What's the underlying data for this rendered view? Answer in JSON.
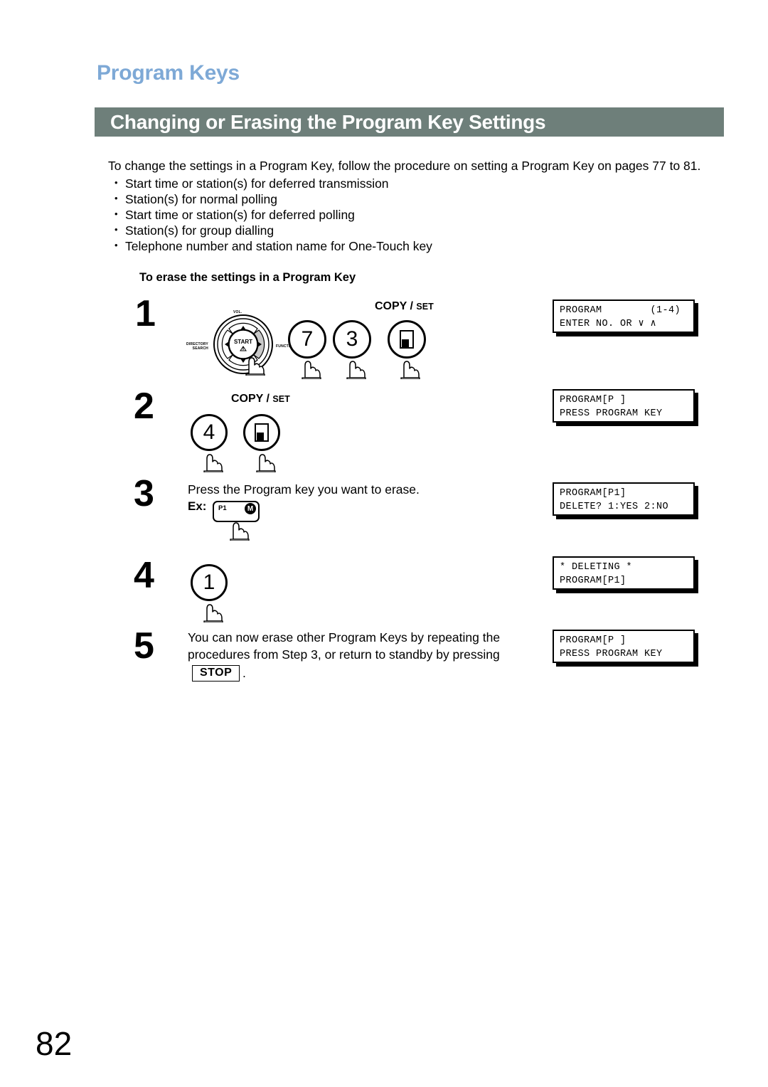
{
  "header": {
    "title": "Program Keys",
    "title_color": "#7ea9d6",
    "section_bar_label": "Changing or Erasing the Program Key Settings",
    "section_bar_color": "#6e7f7a"
  },
  "intro": {
    "lead": "To change the settings in a Program Key, follow the procedure on setting a Program Key on pages 77 to 81.",
    "bullets": [
      "Start time or station(s) for deferred transmission",
      "Station(s) for normal polling",
      "Start time or station(s) for deferred polling",
      "Station(s) for group dialling",
      "Telephone number and station name for One-Touch key"
    ]
  },
  "procedure": {
    "sub_heading": "To erase the settings in a Program Key",
    "steps": [
      {
        "number": "1"
      },
      {
        "number": "2"
      },
      {
        "number": "3",
        "text": "Press the Program key you want to erase.",
        "ex_label": "Ex:"
      },
      {
        "number": "4"
      },
      {
        "number": "5",
        "text": "You can now erase other Program Keys by repeating the procedures from Step 3, or return to standby by pressing",
        "stop_label": "STOP",
        "trailing": "."
      }
    ]
  },
  "keys": {
    "copyset_label_big": "COPY",
    "copyset_label_slash": " / ",
    "copyset_label_small": "SET",
    "key_7": "7",
    "key_3": "3",
    "key_4": "4",
    "key_1": "1",
    "program_key_label": "P1",
    "program_key_memory": "M"
  },
  "nav_wheel": {
    "center_label": "START",
    "volume_label": "VOL.",
    "directory_label_line1": "DIRECTORY",
    "directory_label_line2": "SEARCH",
    "function_label": "FUNCTION"
  },
  "lcd_displays": [
    {
      "line1": "PROGRAM        (1-4)",
      "line2": "ENTER NO. OR ∨ ∧"
    },
    {
      "line1": "PROGRAM[P ]",
      "line2": "PRESS PROGRAM KEY"
    },
    {
      "line1": "PROGRAM[P1]",
      "line2": "DELETE? 1:YES 2:NO"
    },
    {
      "line1": "* DELETING *",
      "line2": "PROGRAM[P1]"
    },
    {
      "line1": "PROGRAM[P ]",
      "line2": "PRESS PROGRAM KEY"
    }
  ],
  "footer": {
    "page_number": "82"
  }
}
